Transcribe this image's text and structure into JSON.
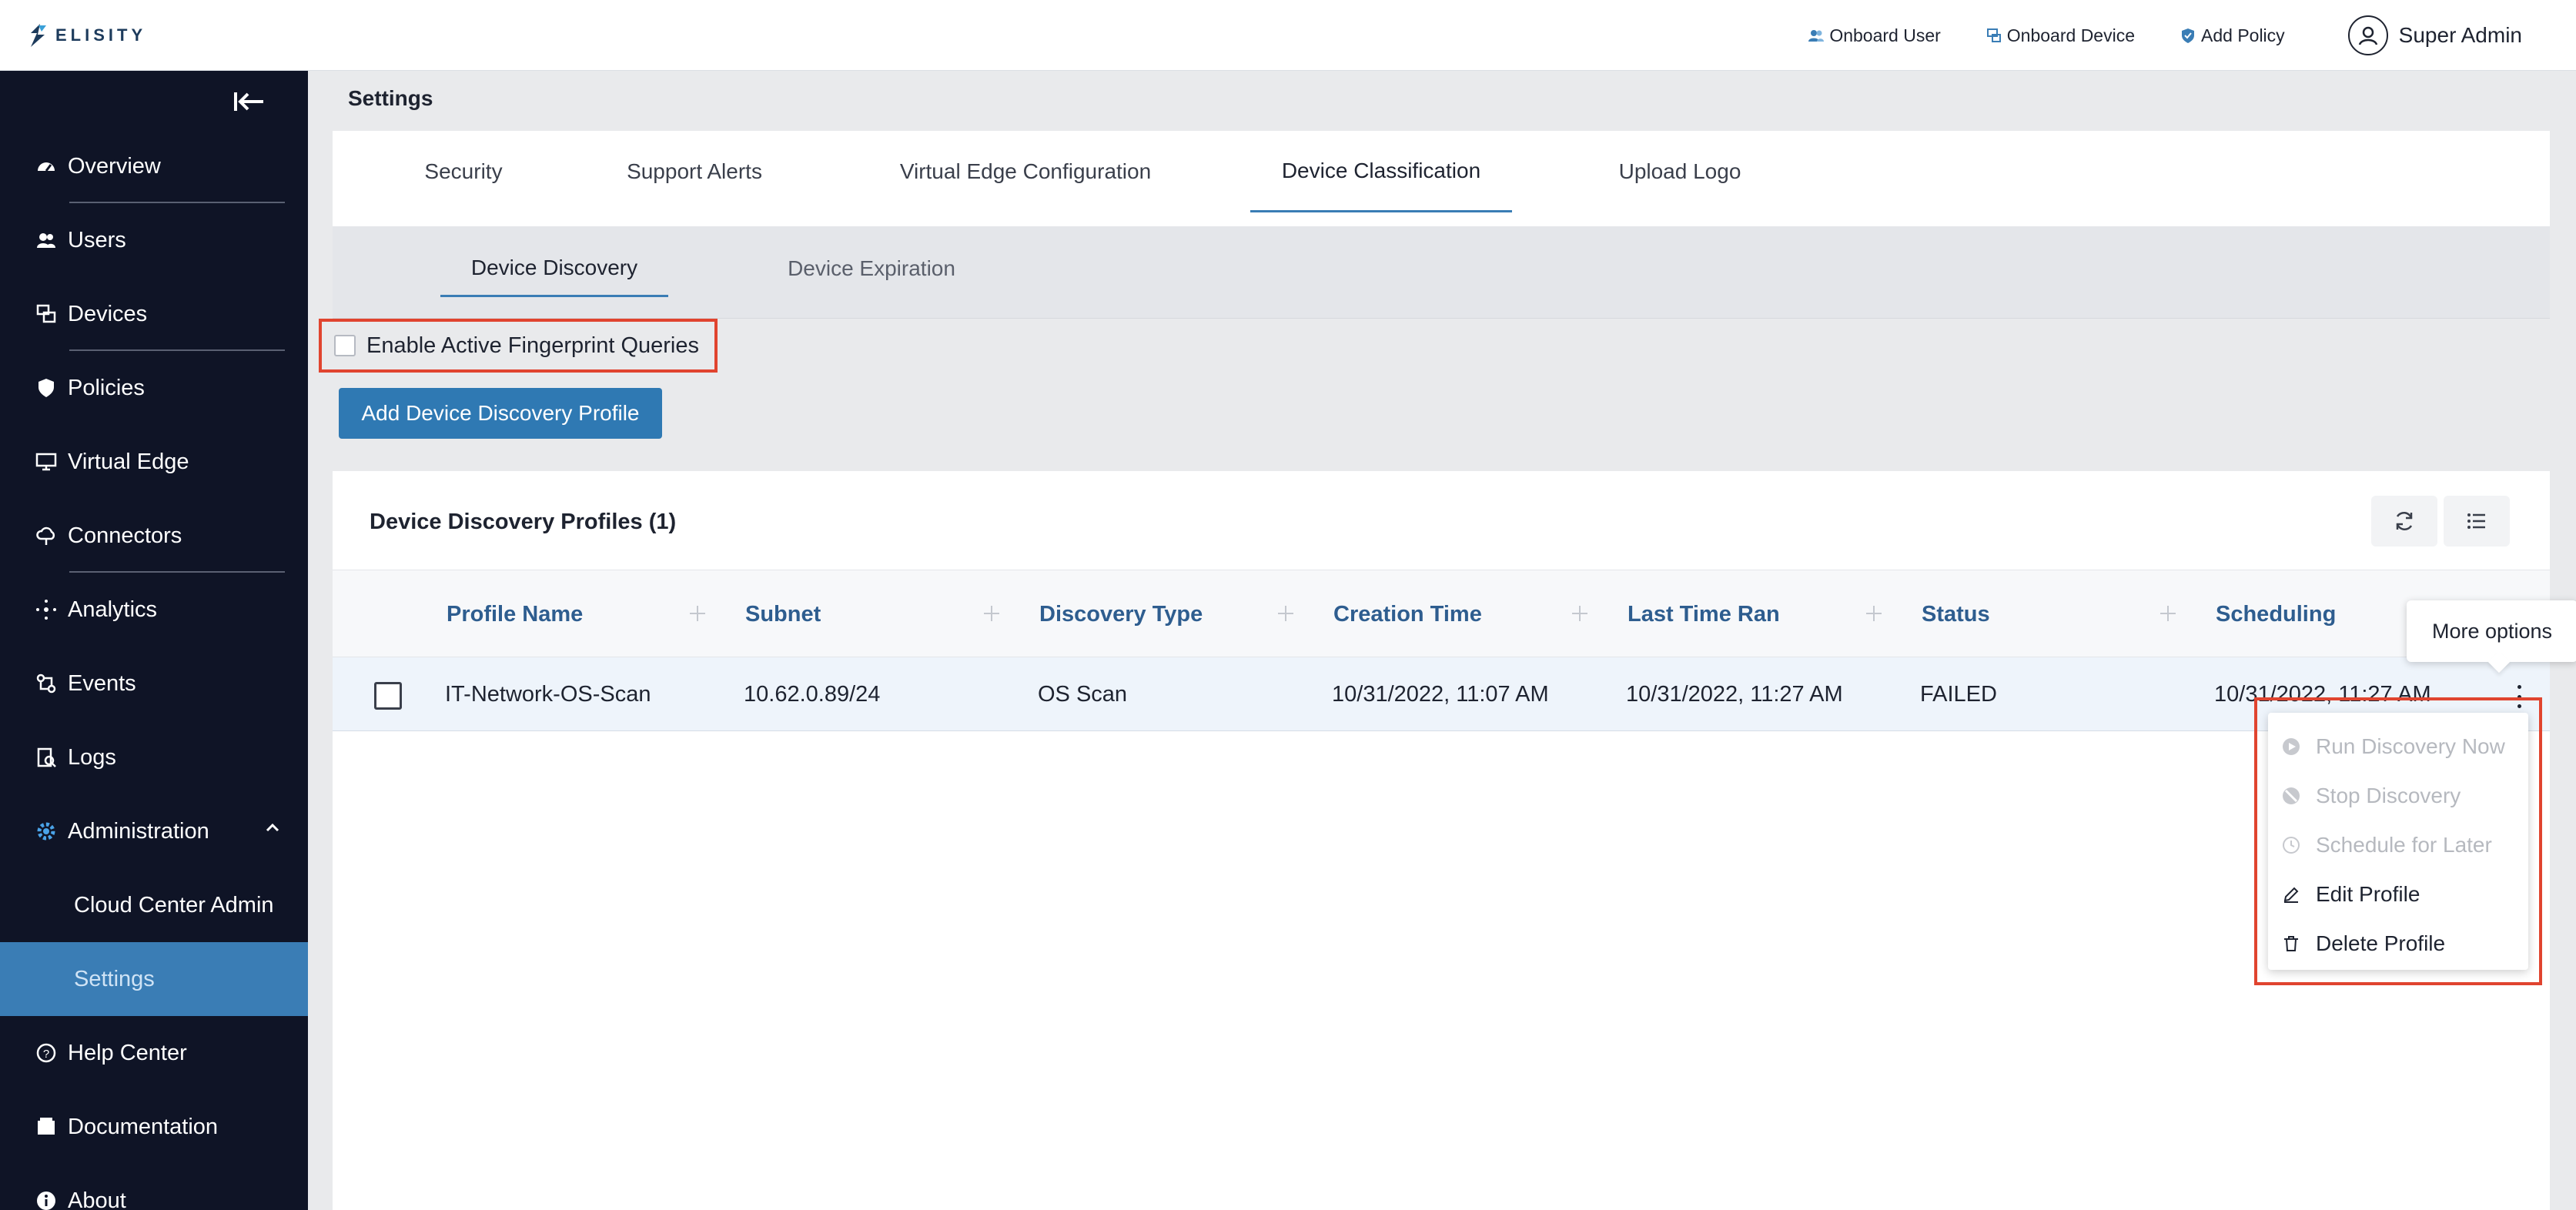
{
  "topbar": {
    "logo_text": "ELISITY",
    "actions": [
      {
        "label": "Onboard User",
        "icon": "users-icon"
      },
      {
        "label": "Onboard Device",
        "icon": "device-icon"
      },
      {
        "label": "Add Policy",
        "icon": "shield-icon"
      }
    ],
    "user_name": "Super Admin"
  },
  "sidebar": {
    "items": [
      {
        "label": "Overview",
        "icon": "dashboard-icon"
      },
      {
        "label": "Users",
        "icon": "users-icon"
      },
      {
        "label": "Devices",
        "icon": "devices-icon"
      },
      {
        "label": "Policies",
        "icon": "shield-icon"
      },
      {
        "label": "Virtual Edge",
        "icon": "monitor-icon"
      },
      {
        "label": "Connectors",
        "icon": "cloud-icon"
      },
      {
        "label": "Analytics",
        "icon": "analytics-icon"
      },
      {
        "label": "Events",
        "icon": "events-icon"
      },
      {
        "label": "Logs",
        "icon": "logs-icon"
      },
      {
        "label": "Administration",
        "icon": "gear-icon"
      },
      {
        "label": "Cloud Center Admin"
      },
      {
        "label": "Settings"
      },
      {
        "label": "Help Center",
        "icon": "help-icon"
      },
      {
        "label": "Documentation",
        "icon": "document-icon"
      },
      {
        "label": "About",
        "icon": "info-icon"
      }
    ]
  },
  "page": {
    "title": "Settings"
  },
  "tabs": [
    "Security",
    "Support Alerts",
    "Virtual Edge Configuration",
    "Device Classification",
    "Upload Logo"
  ],
  "subtabs": [
    "Device Discovery",
    "Device Expiration"
  ],
  "fingerprint": {
    "label": "Enable Active Fingerprint Queries",
    "checked": false
  },
  "add_button": "Add Device Discovery Profile",
  "table": {
    "title": "Device Discovery Profiles (1)",
    "columns": [
      "Profile Name",
      "Subnet",
      "Discovery Type",
      "Creation Time",
      "Last Time Ran",
      "Status",
      "Scheduling"
    ],
    "rows": [
      [
        "IT-Network-OS-Scan",
        "10.62.0.89/24",
        "OS Scan",
        "10/31/2022, 11:07 AM",
        "10/31/2022, 11:27 AM",
        "FAILED",
        "10/31/2022, 11:27 AM"
      ]
    ]
  },
  "tooltip": "More options",
  "menu": [
    {
      "label": "Run Discovery Now",
      "disabled": true,
      "icon": "play-icon"
    },
    {
      "label": "Stop Discovery",
      "disabled": true,
      "icon": "stop-icon"
    },
    {
      "label": "Schedule for Later",
      "disabled": true,
      "icon": "clock-icon"
    },
    {
      "label": "Edit Profile",
      "disabled": false,
      "icon": "pencil-icon"
    },
    {
      "label": "Delete Profile",
      "disabled": false,
      "icon": "trash-icon"
    }
  ]
}
